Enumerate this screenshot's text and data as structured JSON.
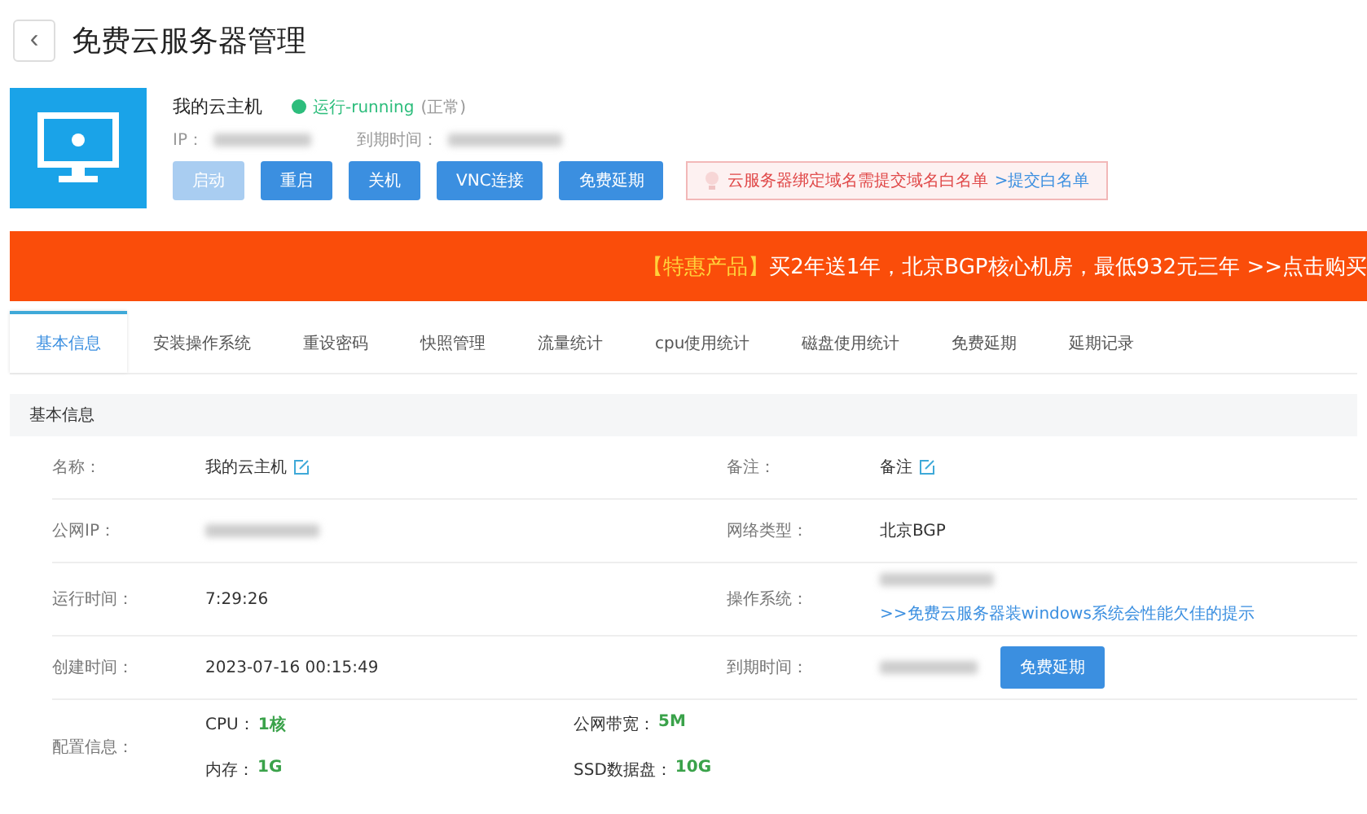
{
  "header": {
    "back": "‹",
    "title": "免费云服务器管理"
  },
  "server": {
    "name": "我的云主机",
    "status": "运行-running",
    "status_note": "(正常)",
    "ip_label": "IP：",
    "expire_label": "到期时间：",
    "buttons": [
      {
        "label": "启动",
        "disabled": true
      },
      {
        "label": "重启",
        "disabled": false
      },
      {
        "label": "关机",
        "disabled": false
      },
      {
        "label": "VNC连接",
        "disabled": false
      },
      {
        "label": "免费延期",
        "disabled": false
      }
    ],
    "notice": {
      "text": "云服务器绑定域名需提交域名白名单",
      "link": ">提交白名单"
    }
  },
  "banner": {
    "tag": "【特惠产品】",
    "text": "买2年送1年，北京BGP核心机房，最低932元三年 >>点击购买"
  },
  "tabs": [
    {
      "label": "基本信息",
      "selected": true
    },
    {
      "label": "安装操作系统",
      "selected": false
    },
    {
      "label": "重设密码",
      "selected": false
    },
    {
      "label": "快照管理",
      "selected": false
    },
    {
      "label": "流量统计",
      "selected": false
    },
    {
      "label": "cpu使用统计",
      "selected": false
    },
    {
      "label": "磁盘使用统计",
      "selected": false
    },
    {
      "label": "免费延期",
      "selected": false
    },
    {
      "label": "延期记录",
      "selected": false
    }
  ],
  "section": {
    "title": "基本信息",
    "rows": [
      {
        "cells": [
          {
            "label": "名称：",
            "value": "我的云主机",
            "editable": true
          },
          {
            "label": "备注：",
            "value": "备注",
            "editable": true
          }
        ]
      },
      {
        "cells": [
          {
            "label": "公网IP：",
            "blurred": true
          },
          {
            "label": "网络类型：",
            "value": "北京BGP"
          }
        ]
      },
      {
        "cells": [
          {
            "label": "运行时间：",
            "value": "7:29:26"
          },
          {
            "label": "操作系统：",
            "blurred": true,
            "link": ">>免费云服务器装windows系统会性能欠佳的提示"
          }
        ]
      },
      {
        "cells": [
          {
            "label": "创建时间：",
            "value": "2023-07-16 00:15:49"
          },
          {
            "label": "到期时间：",
            "blurred": true,
            "button": "免费延期"
          }
        ]
      }
    ],
    "config": {
      "label": "配置信息：",
      "items": [
        {
          "label": "CPU：",
          "value": "1核"
        },
        {
          "label": "公网带宽：",
          "value": "5M"
        },
        {
          "label": "内存：",
          "value": "1G"
        },
        {
          "label": "SSD数据盘：",
          "value": "10G"
        }
      ]
    }
  }
}
